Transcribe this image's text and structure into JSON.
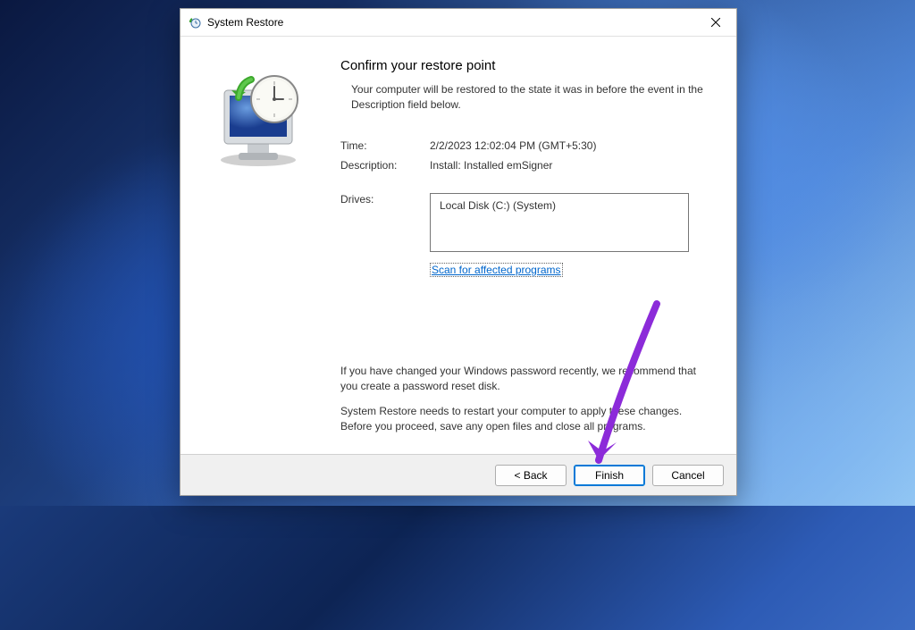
{
  "titlebar": {
    "title": "System Restore"
  },
  "main": {
    "heading": "Confirm your restore point",
    "subtext": "Your computer will be restored to the state it was in before the event in the Description field below.",
    "time_label": "Time:",
    "time_value": "2/2/2023 12:02:04 PM (GMT+5:30)",
    "description_label": "Description:",
    "description_value": "Install: Installed emSigner",
    "drives_label": "Drives:",
    "drives_value": "Local Disk (C:) (System)",
    "scan_link": "Scan for affected programs",
    "note1": "If you have changed your Windows password recently, we recommend that you create a password reset disk.",
    "note2": "System Restore needs to restart your computer to apply these changes. Before you proceed, save any open files and close all programs."
  },
  "buttons": {
    "back": "< Back",
    "finish": "Finish",
    "cancel": "Cancel"
  },
  "annotation": {
    "arrow_color": "#8C2BD9"
  }
}
